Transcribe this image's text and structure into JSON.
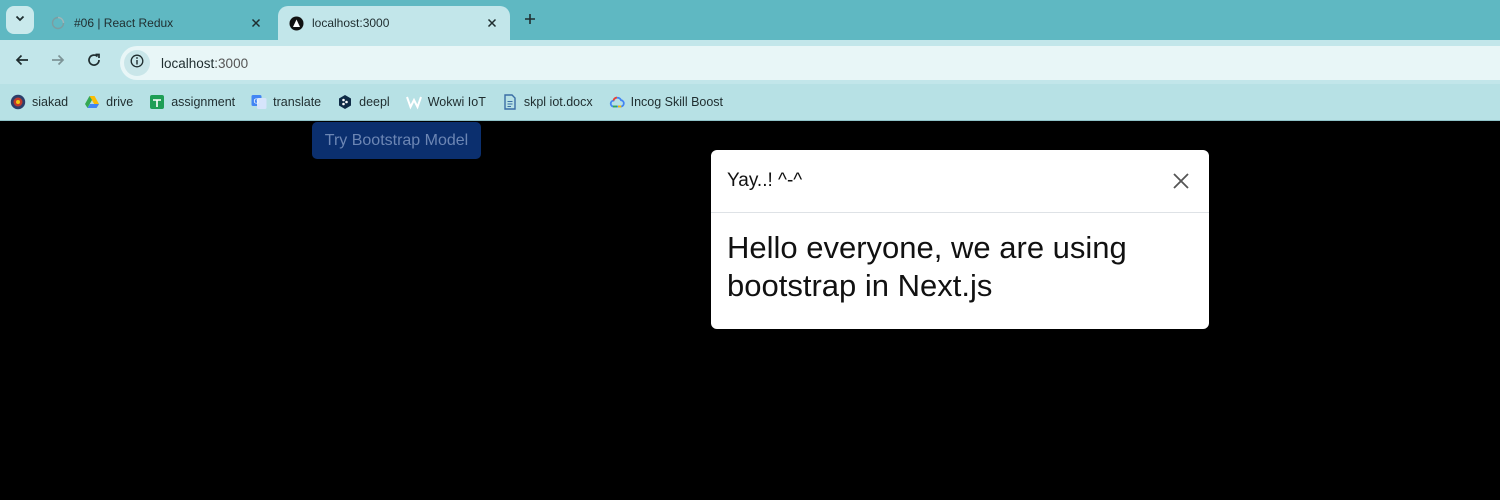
{
  "browser": {
    "tabs": [
      {
        "title": "#06 | React Redux",
        "active": false,
        "favicon": "loading-globe-icon"
      },
      {
        "title": "localhost:3000",
        "active": true,
        "favicon": "nextjs-icon"
      }
    ],
    "address": {
      "host": "localhost",
      "port": ":3000"
    },
    "bookmarks": [
      {
        "label": "siakad",
        "icon": "university-seal-icon"
      },
      {
        "label": "drive",
        "icon": "google-drive-icon"
      },
      {
        "label": "assignment",
        "icon": "google-sheets-icon"
      },
      {
        "label": "translate",
        "icon": "google-translate-icon"
      },
      {
        "label": "deepl",
        "icon": "deepl-icon"
      },
      {
        "label": "Wokwi IoT",
        "icon": "wokwi-icon"
      },
      {
        "label": "skpl iot.docx",
        "icon": "document-icon"
      },
      {
        "label": "Incog Skill Boost",
        "icon": "google-cloud-icon"
      }
    ],
    "colors": {
      "tabstrip": "#5fb8c2",
      "toolbar": "#c2e6ea",
      "bookmarks": "#b7e1e5"
    }
  },
  "page": {
    "try_button": "Try Bootstrap Model",
    "modal": {
      "title": "Yay..! ^-^",
      "body": "Hello everyone, we are using bootstrap in Next.js"
    },
    "colors": {
      "background": "#000000",
      "button_bg": "#0b2f6e",
      "button_text": "#6c86b4"
    }
  }
}
